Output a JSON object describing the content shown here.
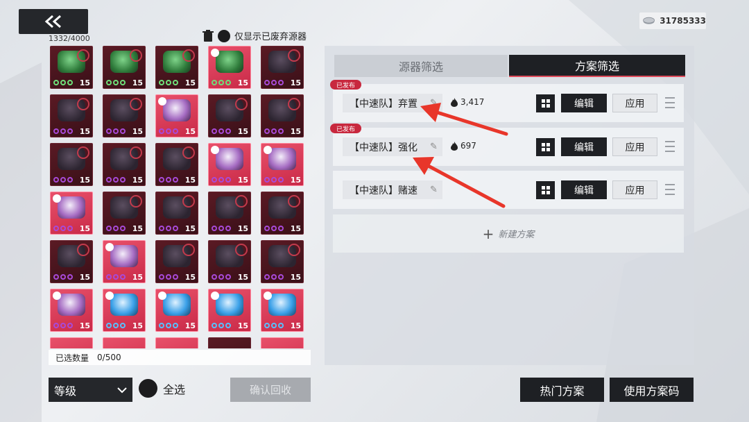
{
  "header": {
    "capacity": "1332/4000",
    "discard_toggle_label": "仅显示已废弃源器",
    "currency_amount": "31785333"
  },
  "inventory": {
    "slots": [
      {
        "style": "dark",
        "item": "green",
        "dots": "g",
        "level": "15"
      },
      {
        "style": "dark",
        "item": "green",
        "dots": "g",
        "level": "15"
      },
      {
        "style": "dark",
        "item": "green",
        "dots": "g",
        "level": "15"
      },
      {
        "style": "bright",
        "item": "green",
        "dots": "g",
        "level": "15",
        "corner": true
      },
      {
        "style": "dark",
        "item": "dark",
        "dots": "p",
        "level": "15"
      },
      {
        "style": "dark",
        "item": "dark",
        "dots": "p",
        "level": "15"
      },
      {
        "style": "dark",
        "item": "dark",
        "dots": "p",
        "level": "15"
      },
      {
        "style": "bright",
        "item": "bright",
        "dots": "p",
        "level": "15",
        "corner": true
      },
      {
        "style": "dark",
        "item": "dark",
        "dots": "p",
        "level": "15"
      },
      {
        "style": "dark",
        "item": "dark",
        "dots": "p",
        "level": "15"
      },
      {
        "style": "dark",
        "item": "dark",
        "dots": "p",
        "level": "15"
      },
      {
        "style": "dark",
        "item": "dark",
        "dots": "p",
        "level": "15"
      },
      {
        "style": "dark",
        "item": "dark",
        "dots": "p",
        "level": "15"
      },
      {
        "style": "bright",
        "item": "bright",
        "dots": "p",
        "level": "15",
        "corner": true
      },
      {
        "style": "bright",
        "item": "bright",
        "dots": "p",
        "level": "15",
        "corner": true
      },
      {
        "style": "bright",
        "item": "bright",
        "dots": "p",
        "level": "15",
        "corner": true
      },
      {
        "style": "dark",
        "item": "dark",
        "dots": "p",
        "level": "15"
      },
      {
        "style": "dark",
        "item": "dark",
        "dots": "p",
        "level": "15"
      },
      {
        "style": "dark",
        "item": "dark",
        "dots": "p",
        "level": "15"
      },
      {
        "style": "dark",
        "item": "dark",
        "dots": "p",
        "level": "15"
      },
      {
        "style": "dark",
        "item": "dark",
        "dots": "p",
        "level": "15"
      },
      {
        "style": "bright",
        "item": "bright",
        "dots": "p",
        "level": "15",
        "corner": true
      },
      {
        "style": "dark",
        "item": "dark",
        "dots": "p",
        "level": "15"
      },
      {
        "style": "dark",
        "item": "dark",
        "dots": "p",
        "level": "15"
      },
      {
        "style": "dark",
        "item": "dark",
        "dots": "p",
        "level": "15"
      },
      {
        "style": "bright",
        "item": "bright",
        "dots": "p",
        "level": "15",
        "corner": true
      },
      {
        "style": "bright",
        "item": "blue",
        "dots": "b",
        "level": "15",
        "corner": true
      },
      {
        "style": "bright",
        "item": "blue",
        "dots": "b",
        "level": "15",
        "corner": true
      },
      {
        "style": "bright",
        "item": "blue",
        "dots": "b",
        "level": "15",
        "corner": true
      },
      {
        "style": "bright",
        "item": "blue",
        "dots": "b",
        "level": "15",
        "corner": true
      }
    ],
    "selected_label": "已选数量",
    "selected_value": "0/500"
  },
  "footer_left": {
    "sort_label": "等级",
    "select_all_label": "全选",
    "confirm_label": "确认回收"
  },
  "tabs": {
    "device_filter": "源器筛选",
    "plan_filter": "方案筛选"
  },
  "plans": [
    {
      "published": true,
      "badge": "已发布",
      "name": "【中速队】弃置",
      "heat": "3,417",
      "edit": "编辑",
      "apply": "应用"
    },
    {
      "published": true,
      "badge": "已发布",
      "name": "【中速队】强化",
      "heat": "697",
      "edit": "编辑",
      "apply": "应用"
    },
    {
      "published": false,
      "badge": "",
      "name": "【中速队】赌速",
      "heat": "",
      "edit": "编辑",
      "apply": "应用"
    }
  ],
  "new_plan_label": "新建方案",
  "footer_right": {
    "hot_plans": "热门方案",
    "use_code": "使用方案码"
  },
  "colors": {
    "accent_red": "#c8283e",
    "dark_button": "#1e2024"
  }
}
